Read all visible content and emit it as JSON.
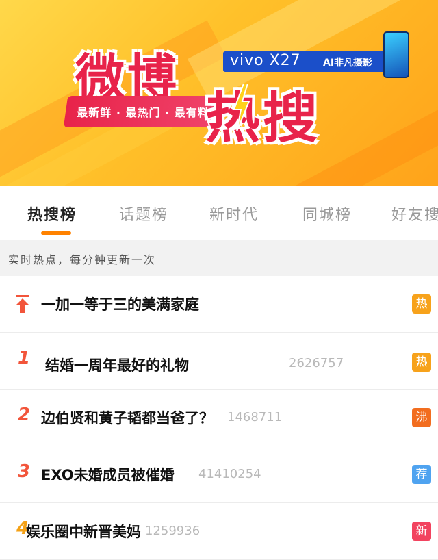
{
  "banner": {
    "title_part1": "微博",
    "title_part2": "热搜",
    "slogan": "最新鲜 · 最热门 · 最有料",
    "sponsor_brand": "vivo X27",
    "sponsor_slogan": "AI非凡摄影"
  },
  "tabs": [
    {
      "label": "热搜榜",
      "active": true
    },
    {
      "label": "话题榜",
      "active": false
    },
    {
      "label": "新时代",
      "active": false
    },
    {
      "label": "同城榜",
      "active": false
    },
    {
      "label": "好友搜",
      "active": false
    }
  ],
  "hint": "实时热点，每分钟更新一次",
  "items": [
    {
      "rank": "",
      "pinned": true,
      "title": "一加一等于三的美满家庭",
      "count": "",
      "badge": "热",
      "badge_color": "#f7a21b"
    },
    {
      "rank": "1",
      "pinned": false,
      "title": "结婚一周年最好的礼物",
      "count": "2626757",
      "badge": "热",
      "badge_color": "#f7a21b"
    },
    {
      "rank": "2",
      "pinned": false,
      "title": "边伯贤和黄子韬都当爸了？",
      "count": "1468711",
      "badge": "沸",
      "badge_color": "#f26d1f"
    },
    {
      "rank": "3",
      "pinned": false,
      "title": "EXO未婚成员被催婚",
      "count": "41410254",
      "badge": "荐",
      "badge_color": "#4fa3f0"
    },
    {
      "rank": "4",
      "pinned": false,
      "title": "娱乐圈中新晋美妈",
      "count": "1259936",
      "badge": "新",
      "badge_color": "#f2435f"
    }
  ],
  "colors": {
    "accent": "#ff8200",
    "rank_red": "#f2553b",
    "rank_gold": "#f4a116"
  }
}
